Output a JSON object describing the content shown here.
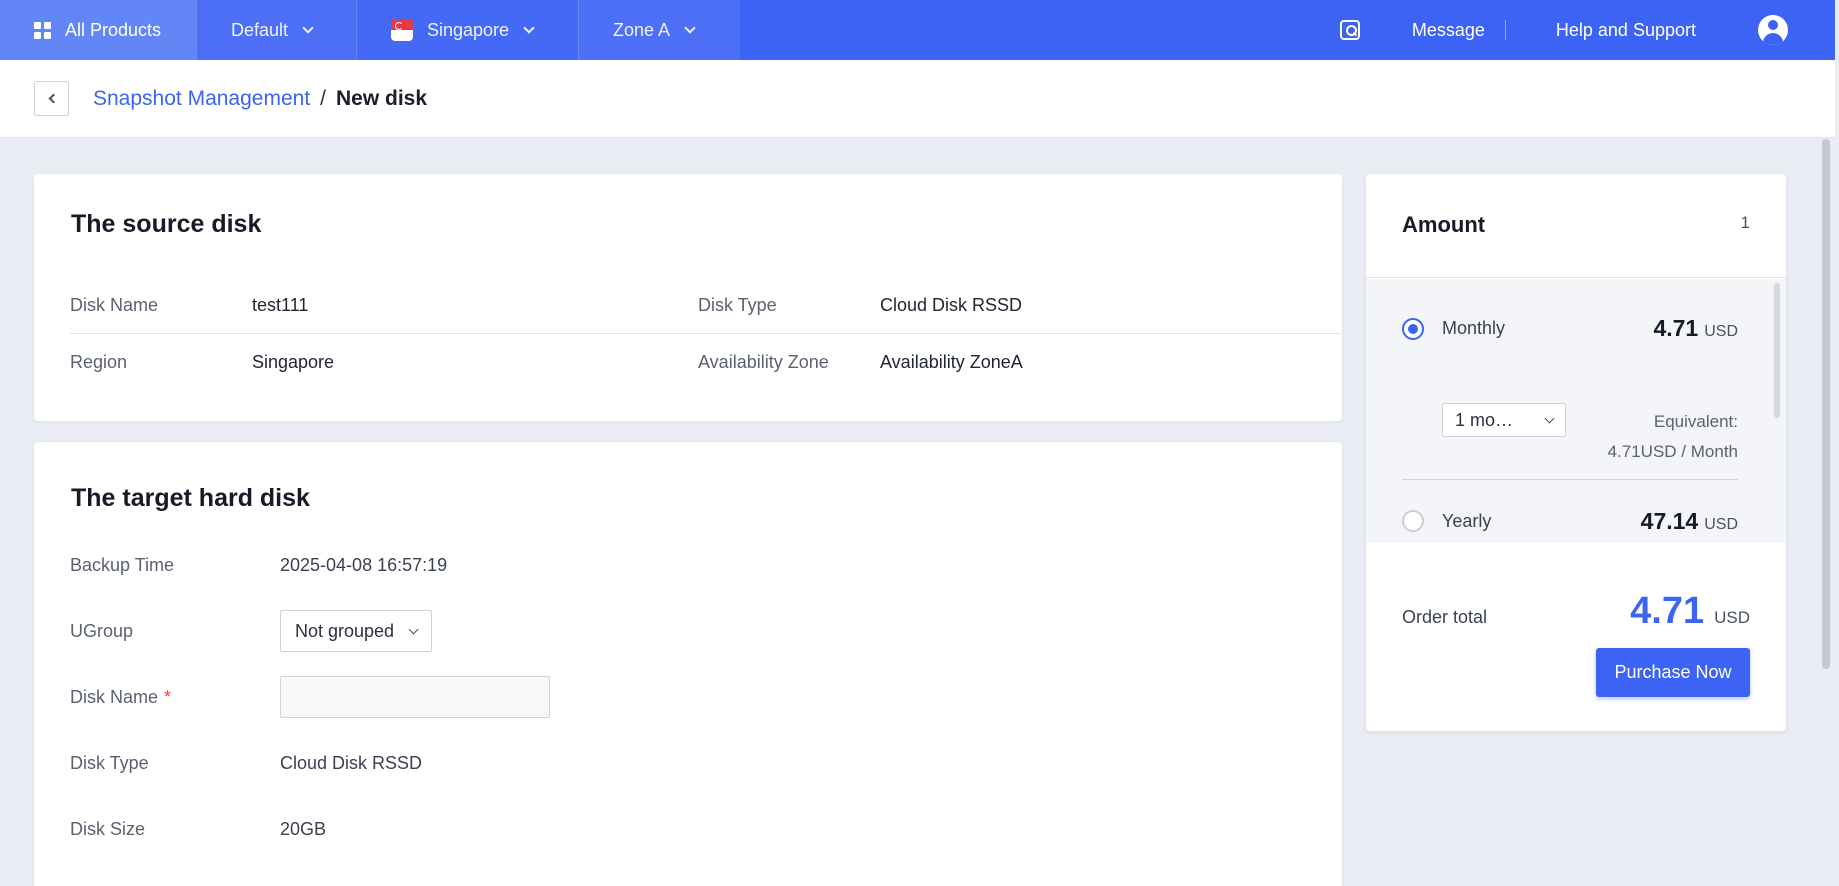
{
  "topbar": {
    "all_products": "All Products",
    "project": "Default",
    "region": "Singapore",
    "zone": "Zone A",
    "message": "Message",
    "help": "Help and Support"
  },
  "breadcrumb": {
    "parent": "Snapshot Management",
    "separator": "/",
    "current": "New disk"
  },
  "source_disk": {
    "title": "The source disk",
    "disk_name_label": "Disk Name",
    "disk_name": "test111",
    "disk_type_label": "Disk Type",
    "disk_type": "Cloud Disk RSSD",
    "region_label": "Region",
    "region": "Singapore",
    "zone_label": "Availability Zone",
    "zone": "Availability ZoneA"
  },
  "target_disk": {
    "title": "The target hard disk",
    "backup_time_label": "Backup Time",
    "backup_time": "2025-04-08 16:57:19",
    "ugroup_label": "UGroup",
    "ugroup_value": "Not grouped",
    "disk_name_label": "Disk Name",
    "disk_name_value": "",
    "disk_name_required": "*",
    "disk_type_label": "Disk Type",
    "disk_type": "Cloud Disk RSSD",
    "disk_size_label": "Disk Size",
    "disk_size": "20GB"
  },
  "amount": {
    "title": "Amount",
    "quantity": "1",
    "monthly": {
      "label": "Monthly",
      "price": "4.71",
      "currency": "USD",
      "duration": "1 mo…",
      "equivalent_label": "Equivalent:",
      "equivalent_value": "4.71USD / Month",
      "selected": true
    },
    "yearly": {
      "label": "Yearly",
      "price": "47.14",
      "currency": "USD",
      "selected": false
    },
    "order_total_label": "Order total",
    "order_total": "4.71",
    "order_currency": "USD",
    "purchase_label": "Purchase Now"
  },
  "colors": {
    "brand": "#3d63f5",
    "required": "#e5484d"
  }
}
